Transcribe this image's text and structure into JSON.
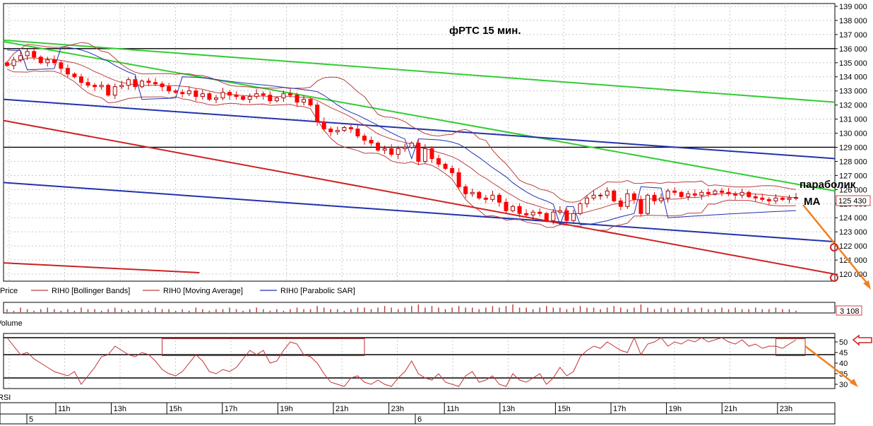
{
  "chart_data": [
    {
      "type": "candlestick",
      "title": "фРТС    15 мин.",
      "annotations": [
        "параболик",
        "MA"
      ],
      "ylim": [
        119500,
        139200
      ],
      "y_ticks": [
        120000,
        121000,
        122000,
        123000,
        124000,
        125000,
        126000,
        127000,
        128000,
        129000,
        130000,
        131000,
        132000,
        133000,
        134000,
        135000,
        136000,
        137000,
        138000,
        139000
      ],
      "y_tick_labels": [
        "120 000",
        "121 000",
        "122 000",
        "123 000",
        "124 000",
        "125 000",
        "126 000",
        "127 000",
        "128 000",
        "129 000",
        "130 000",
        "131 000",
        "132 000",
        "133 000",
        "134 000",
        "135 000",
        "136 000",
        "137 000",
        "138 000",
        "139 000"
      ],
      "last_price_label": "125 430",
      "legend": [
        "Price",
        "RIH0 [Bollinger Bands]",
        "RIH0 [Moving Average]",
        "RIH0 [Parabolic SAR]"
      ],
      "grid": true,
      "x_range": [
        0,
        140
      ],
      "series": [
        {
          "name": "Price",
          "close": [
            134800,
            135200,
            135500,
            135800,
            135400,
            135000,
            135200,
            135000,
            134600,
            134200,
            134000,
            133600,
            133400,
            133300,
            133400,
            132700,
            133300,
            133400,
            133800,
            133300,
            133700,
            133600,
            133500,
            133300,
            133000,
            132900,
            132800,
            133000,
            132600,
            132800,
            132400,
            132500,
            132900,
            132700,
            132600,
            132400,
            132600,
            132800,
            132700,
            132300,
            132500,
            132800,
            132700,
            132200,
            132400,
            132000,
            130800,
            130300,
            130100,
            130200,
            130400,
            130300,
            129800,
            129500,
            129300,
            128800,
            128900,
            128500,
            128900,
            129000,
            129300,
            128000,
            128900,
            128200,
            127800,
            127500,
            127200,
            126200,
            125700,
            125800,
            125400,
            125300,
            125600,
            125100,
            124500,
            124800,
            124300,
            124200,
            124400,
            124300,
            123800,
            124400,
            124500,
            123800,
            124300,
            125000,
            125400,
            125600,
            125600,
            125900,
            125200,
            124800,
            125700,
            125300,
            124300,
            125600,
            125200,
            125400,
            125900,
            125800,
            125500,
            125700,
            125600,
            125800,
            125700,
            125900,
            125800,
            125700,
            125600,
            125800,
            125500,
            125400,
            125300,
            125200,
            125400,
            125300,
            125400,
            125430
          ]
        },
        {
          "name": "Horizontal levels",
          "values": [
            136000,
            129000
          ]
        },
        {
          "name": "Green trendline 1",
          "points": [
            [
              0,
              136600
            ],
            [
              140,
              132200
            ]
          ]
        },
        {
          "name": "Green trendline 2",
          "points": [
            [
              0,
              136500
            ],
            [
              140,
              125900
            ]
          ]
        },
        {
          "name": "Blue trendline 1",
          "points": [
            [
              0,
              132400
            ],
            [
              140,
              128200
            ]
          ]
        },
        {
          "name": "Blue trendline 2",
          "points": [
            [
              0,
              126500
            ],
            [
              140,
              122300
            ]
          ]
        },
        {
          "name": "Red trendline",
          "points": [
            [
              0,
              130900
            ],
            [
              140,
              120000
            ]
          ]
        },
        {
          "name": "Red trendline short",
          "points": [
            [
              0,
              120800
            ],
            [
              33,
              120100
            ]
          ]
        }
      ]
    },
    {
      "type": "bar",
      "title": "",
      "ylabel": "Volume",
      "last_value_label": "3 108",
      "values": [
        2,
        1,
        3,
        2,
        1,
        2,
        3,
        2,
        1,
        2,
        1,
        3,
        2,
        2,
        1,
        2,
        3,
        2,
        1,
        2,
        2,
        1,
        3,
        2,
        2,
        1,
        2,
        1,
        3,
        2,
        1,
        2,
        2,
        3,
        2,
        1,
        2,
        3,
        2,
        1,
        2,
        1,
        2,
        3,
        2,
        2,
        4,
        3,
        2,
        2,
        1,
        2,
        3,
        3,
        2,
        3,
        4,
        3,
        2,
        3,
        4,
        5,
        3,
        4,
        3,
        2,
        3,
        4,
        3,
        3,
        2,
        3,
        4,
        3,
        4,
        5,
        3,
        3,
        2,
        3,
        4,
        3,
        3,
        2,
        3,
        4,
        3,
        3,
        2,
        3,
        4,
        3,
        2,
        3,
        5,
        3,
        2,
        3,
        2,
        3,
        2,
        3,
        2,
        3,
        2,
        2,
        3,
        2,
        3,
        2,
        2,
        3,
        2,
        2,
        3,
        2,
        2,
        1
      ]
    },
    {
      "type": "line",
      "title": "",
      "ylabel": "RSI",
      "ylim": [
        28,
        54
      ],
      "y_ticks": [
        30,
        35,
        40,
        45,
        50
      ],
      "y_tick_labels": [
        "30",
        "35",
        "40",
        "45",
        "50"
      ],
      "levels": [
        52,
        44,
        33
      ],
      "series": [
        {
          "name": "RSI",
          "values": [
            52,
            48,
            44,
            45,
            42,
            40,
            38,
            36,
            35,
            34,
            36,
            30,
            34,
            38,
            43,
            44,
            48,
            46,
            44,
            43,
            45,
            44,
            41,
            37,
            35,
            34,
            36,
            40,
            44,
            41,
            36,
            35,
            37,
            36,
            38,
            42,
            46,
            44,
            46,
            40,
            41,
            46,
            50,
            49,
            44,
            43,
            40,
            35,
            31,
            30,
            29,
            33,
            34,
            31,
            30,
            32,
            30,
            29,
            33,
            36,
            41,
            35,
            33,
            32,
            35,
            31,
            30,
            29,
            34,
            36,
            31,
            32,
            34,
            30,
            29,
            35,
            32,
            31,
            33,
            35,
            30,
            33,
            38,
            34,
            36,
            43,
            46,
            48,
            47,
            50,
            48,
            46,
            45,
            52,
            44,
            49,
            50,
            52,
            48,
            50,
            49,
            51,
            50,
            52,
            50,
            51,
            52,
            50,
            49,
            51,
            48,
            49,
            47,
            48,
            48,
            47,
            49,
            51
          ]
        }
      ],
      "boxes": [
        {
          "x": [
            23,
            53
          ],
          "y": [
            43.5,
            51.5
          ]
        },
        {
          "x": [
            114,
            143
          ],
          "y": [
            43.5,
            51.5
          ]
        }
      ]
    }
  ],
  "time_axis": {
    "hour_labels": [
      "11h",
      "13h",
      "15h",
      "17h",
      "19h",
      "21h",
      "23h",
      "11h",
      "13h",
      "15h",
      "17h",
      "19h",
      "21h",
      "23h"
    ],
    "day_labels": [
      "5",
      "6"
    ]
  },
  "colors": {
    "candle_red": "#ff0000",
    "candle_dark": "#a80000",
    "bollinger": "#b84040",
    "ma": "#c04040",
    "sar": "#2030b0",
    "green_line": "#33cc33",
    "blue_line": "#2233aa",
    "red_line": "#cc2222",
    "annotation_arrow": "#f08020",
    "grid": "#c8c8c8"
  }
}
